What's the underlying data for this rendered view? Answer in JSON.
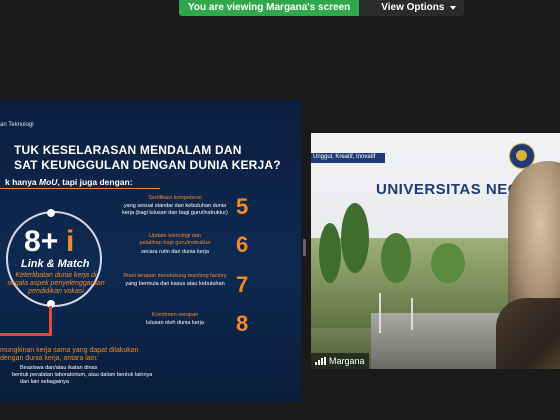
{
  "banner": {
    "message": "You are viewing Margana's screen",
    "view_options": "View Options"
  },
  "slide": {
    "header": "an Teknologi",
    "title_line1": "TUK KESELARASAN MENDALAM DAN",
    "title_line2": "SAT KEUNGGULAN DENGAN DUNIA KERJA?",
    "subtitle_prefix": "k hanya ",
    "subtitle_italic": "MoU",
    "subtitle_suffix": ", tapi juga dengan:",
    "big_8": "8",
    "big_plus": "+",
    "big_i": "i",
    "link_match": "Link & Match",
    "keterlibatan_line1": "Keterlibatan dunia kerja di",
    "keterlibatan_line2": "segala  aspek penyelenggaraan",
    "keterlibatan_line3": "pendidikan vokasi",
    "bottom_heading_line1": "mungkinan kerja sama yang dapat dilakukan",
    "bottom_heading_line2": "dengan dunia kerja, antara lain:",
    "bottom_list_line1": "Beasiswa dan/atau ikatan dinas",
    "bottom_list_line2": "bentuk peralatan laboratorium,  atau dalam bentuk lainnya",
    "bottom_list_line3": "dan lain sebagainya",
    "items": [
      {
        "title1": "Sertifikasi kompetensi",
        "title2": "",
        "desc1": "yang sesuai standar dan kebutuhan dunia",
        "desc2": "kerja (bagi lulusan dan bagi guru/instruktur)",
        "num": "5"
      },
      {
        "title1": "Update teknologi dan",
        "title2": "pelatihan bagi guru/instruktur",
        "desc1": "secara rutin dari dunia kerja",
        "desc2": "",
        "num": "6"
      },
      {
        "title1": "Riset terapan mendukung teaching factory",
        "title2": "",
        "desc1": "yang bermula dari kasus atau kebutuhan",
        "desc2": "",
        "num": "7"
      },
      {
        "title1": "Komitmen serapan",
        "title2": "",
        "desc1": "lulusan oleh dunia kerja",
        "desc2": "",
        "num": "8"
      }
    ]
  },
  "video": {
    "strip_text": "Unggul, Kreatif, Inovatif",
    "university_text": "UNIVERSITAS NEG",
    "participant_name": "Margana"
  },
  "colors": {
    "share_green": "#2ea84a",
    "accent_orange": "#f48a24",
    "slide_navy": "#0e2a52"
  }
}
